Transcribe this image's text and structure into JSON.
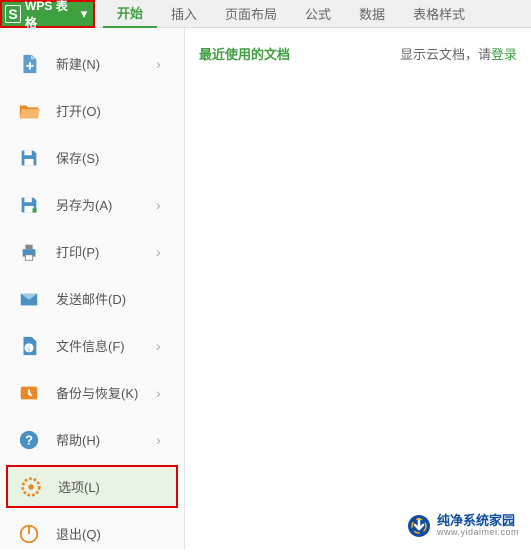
{
  "app": {
    "icon_letter": "S",
    "title": "WPS 表格"
  },
  "tabs": [
    {
      "label": "开始",
      "active": true
    },
    {
      "label": "插入",
      "active": false
    },
    {
      "label": "页面布局",
      "active": false
    },
    {
      "label": "公式",
      "active": false
    },
    {
      "label": "数据",
      "active": false
    },
    {
      "label": "表格样式",
      "active": false
    }
  ],
  "sidebar": {
    "items": [
      {
        "label": "新建(N)",
        "icon": "new",
        "has_chevron": true
      },
      {
        "label": "打开(O)",
        "icon": "open",
        "has_chevron": false
      },
      {
        "label": "保存(S)",
        "icon": "save",
        "has_chevron": false
      },
      {
        "label": "另存为(A)",
        "icon": "saveas",
        "has_chevron": true
      },
      {
        "label": "打印(P)",
        "icon": "print",
        "has_chevron": true
      },
      {
        "label": "发送邮件(D)",
        "icon": "mail",
        "has_chevron": false
      },
      {
        "label": "文件信息(F)",
        "icon": "info",
        "has_chevron": true
      },
      {
        "label": "备份与恢复(K)",
        "icon": "backup",
        "has_chevron": true
      },
      {
        "label": "帮助(H)",
        "icon": "help",
        "has_chevron": true
      },
      {
        "label": "选项(L)",
        "icon": "options",
        "has_chevron": false,
        "highlighted": true
      },
      {
        "label": "退出(Q)",
        "icon": "exit",
        "has_chevron": false
      }
    ]
  },
  "content": {
    "recent_title": "最近使用的文档",
    "cloud_prefix": "显示云文档，请",
    "login_text": "登录"
  },
  "watermark": {
    "name": "纯净系统家园",
    "url": "www.yidaimei.com"
  },
  "icons": {
    "gear_color": "#e98a28",
    "exit_color": "#e98a28",
    "default_color": "#4a90c5"
  }
}
